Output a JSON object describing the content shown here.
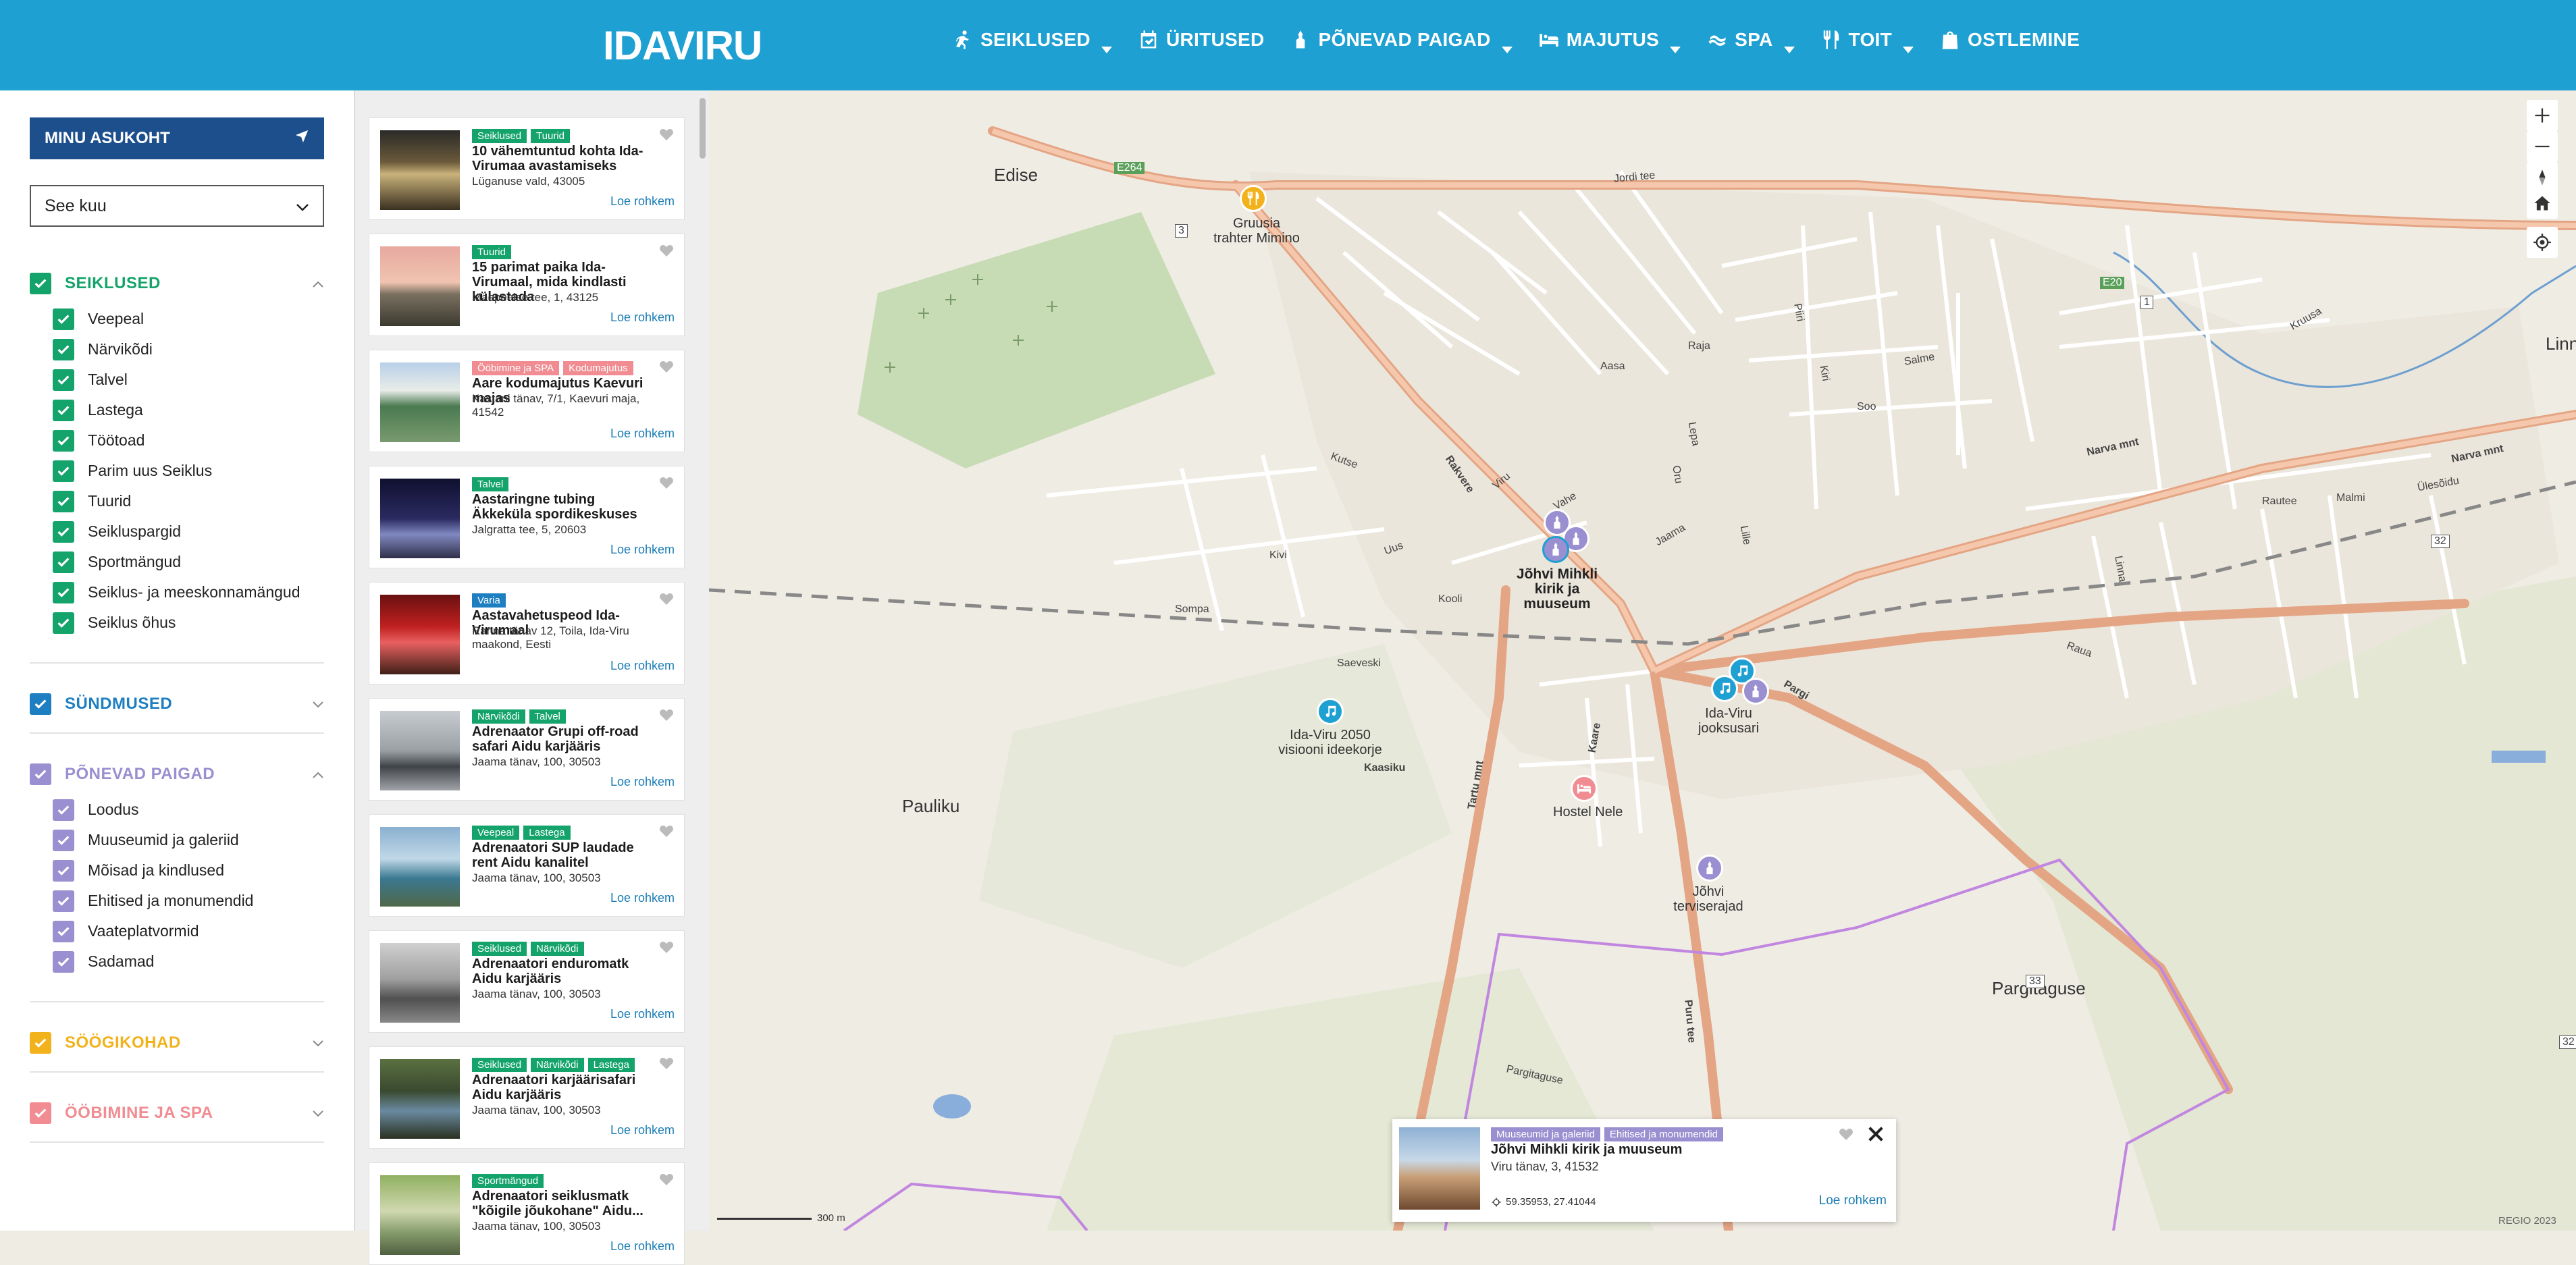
{
  "header": {
    "logo_text": "IDAVIRU",
    "nav": [
      {
        "label": "SEIKLUSED",
        "icon": "running-person-icon",
        "dropdown": true
      },
      {
        "label": "ÜRITUSED",
        "icon": "calendar-check-icon",
        "dropdown": false
      },
      {
        "label": "PÕNEVAD PAIGAD",
        "icon": "landmark-icon",
        "dropdown": true
      },
      {
        "label": "MAJUTUS",
        "icon": "bed-icon",
        "dropdown": true
      },
      {
        "label": "SPA",
        "icon": "spa-icon",
        "dropdown": true
      },
      {
        "label": "TOIT",
        "icon": "fork-knife-icon",
        "dropdown": true
      },
      {
        "label": "OSTLEMINE",
        "icon": "shopping-bag-icon",
        "dropdown": false
      }
    ],
    "color": "#1ea0d2"
  },
  "sidebar": {
    "location_button": "MINU ASUKOHT",
    "date_select": "See kuu",
    "groups": [
      {
        "label": "SEIKLUSED",
        "color": "#14a36b",
        "expanded": true,
        "items": [
          "Veepeal",
          "Närvikõdi",
          "Talvel",
          "Lastega",
          "Töötoad",
          "Parim uus Seiklus",
          "Tuurid",
          "Seikluspargid",
          "Sportmängud",
          "Seiklus- ja meeskonnamängud",
          "Seiklus õhus"
        ]
      },
      {
        "label": "SÜNDMUSED",
        "color": "#1d7fc2",
        "expanded": false,
        "items": []
      },
      {
        "label": "PÕNEVAD PAIGAD",
        "color": "#9a8fd0",
        "expanded": true,
        "items": [
          "Loodus",
          "Muuseumid ja galeriid",
          "Mõisad ja kindlused",
          "Ehitised ja monumendid",
          "Vaateplatvormid",
          "Sadamad"
        ]
      },
      {
        "label": "SÖÖGIKOHAD",
        "color": "#f2b21b",
        "expanded": false,
        "items": []
      },
      {
        "label": "ÖÖBIMINE JA SPA",
        "color": "#f08c92",
        "expanded": false,
        "items": []
      }
    ]
  },
  "list": {
    "more_label": "Loe rohkem",
    "cards": [
      {
        "tags": [
          {
            "t": "Seiklused",
            "c": "#14a36b"
          },
          {
            "t": "Tuurid",
            "c": "#14a36b"
          }
        ],
        "title": "10 vähemtuntud kohta Ida-Virumaa avastamiseks",
        "address": "Lüganuse vald, 43005"
      },
      {
        "tags": [
          {
            "t": "Tuurid",
            "c": "#14a36b"
          }
        ],
        "title": "15 parimat paika Ida-Virumaal, mida kindlasti külastada",
        "address": "Mäepealse tee, 1, 43125"
      },
      {
        "tags": [
          {
            "t": "Ööbimine ja SPA",
            "c": "#f08c92"
          },
          {
            "t": "Kodumajutus",
            "c": "#f08c92"
          }
        ],
        "title": "Aare kodumajutus Kaevuri majas",
        "address": "Kastani tänav, 7/1, Kaevuri maja, 41542"
      },
      {
        "tags": [
          {
            "t": "Talvel",
            "c": "#14a36b"
          }
        ],
        "title": "Aastaringne tubing Äkkeküla spordikeskuses",
        "address": "Jalgratta tee, 5, 20603"
      },
      {
        "tags": [
          {
            "t": "Varia",
            "c": "#1d7fc2"
          }
        ],
        "title": "Aastavahetuspeod Ida-Virumaal",
        "address": "Ranna tänav 12, Toila, Ida-Viru maakond, Eesti"
      },
      {
        "tags": [
          {
            "t": "Närvikõdi",
            "c": "#14a36b"
          },
          {
            "t": "Talvel",
            "c": "#14a36b"
          }
        ],
        "title": "Adrenaator Grupi off-road safari Aidu karjääris",
        "address": "Jaama tänav, 100, 30503"
      },
      {
        "tags": [
          {
            "t": "Veepeal",
            "c": "#14a36b"
          },
          {
            "t": "Lastega",
            "c": "#14a36b"
          }
        ],
        "title": "Adrenaatori SUP laudade rent Aidu kanalitel",
        "address": "Jaama tänav, 100, 30503"
      },
      {
        "tags": [
          {
            "t": "Seiklused",
            "c": "#14a36b"
          },
          {
            "t": "Närvikõdi",
            "c": "#14a36b"
          }
        ],
        "title": "Adrenaatori enduromatk Aidu karjääris",
        "address": "Jaama tänav, 100, 30503"
      },
      {
        "tags": [
          {
            "t": "Seiklused",
            "c": "#14a36b"
          },
          {
            "t": "Närvikõdi",
            "c": "#14a36b"
          },
          {
            "t": "Lastega",
            "c": "#14a36b"
          }
        ],
        "title": "Adrenaatori karjäärisafari Aidu karjääris",
        "address": "Jaama tänav, 100, 30503"
      },
      {
        "tags": [
          {
            "t": "Sportmängud",
            "c": "#14a36b"
          }
        ],
        "title": "Adrenaatori seiklusmatk \"kõigile jõukohane\" Aidu...",
        "address": "Jaama tänav, 100, 30503"
      }
    ]
  },
  "map": {
    "places": [
      "Edise",
      "Pauliku",
      "Pargitaguse",
      "Linna"
    ],
    "pois": [
      {
        "name": "Gruusia trahter Mimino",
        "color": "#f2b21b",
        "icon": "fork-knife-icon"
      },
      {
        "name": "Jõhvi Mihkli kirik ja muuseum",
        "color": "#9a8fd0",
        "icon": "landmark-icon"
      },
      {
        "name": "Ida-Viru 2050 visiooni ideekorje",
        "color": "#1ea0d2",
        "icon": "music-note-icon"
      },
      {
        "name": "Ida-Viru jooksusari",
        "color": "#1ea0d2",
        "icon": "music-note-icon"
      },
      {
        "name": "Hostel Nele",
        "color": "#f08c92",
        "icon": "bed-icon"
      },
      {
        "name": "Jõhvi terviserajad",
        "color": "#9a8fd0",
        "icon": "landmark-icon"
      }
    ],
    "roads": [
      "Narva mnt",
      "Rakvere",
      "Tartu mnt",
      "Kaare",
      "Kaasiku",
      "Pargi",
      "Puru tee",
      "Pargitaguse",
      "Jordi tee",
      "Sompa",
      "Kooli",
      "Saeveski",
      "Raua",
      "Rautee",
      "Ülesõidu",
      "Malmi",
      "Kutse",
      "Vahe",
      "Viru",
      "Jaama",
      "Kivi",
      "Uus",
      "Soo",
      "Salme",
      "Aasa",
      "Raja",
      "Oru",
      "Lepa",
      "Lille",
      "Linna",
      "Kruusa",
      "Piiri",
      "Kiri"
    ],
    "road_numbers": [
      "E264",
      "3",
      "E20",
      "1",
      "32",
      "33"
    ],
    "popup": {
      "tags": [
        "Muuseumid ja galeriid",
        "Ehitised ja monumendid"
      ],
      "title": "Jõhvi Mihkli kirik ja muuseum",
      "address": "Viru tänav, 3, 41532",
      "coords": "59.35953, 27.41044",
      "more": "Loe rohkem"
    },
    "scale": "300 m",
    "attribution": "REGIO 2023"
  }
}
